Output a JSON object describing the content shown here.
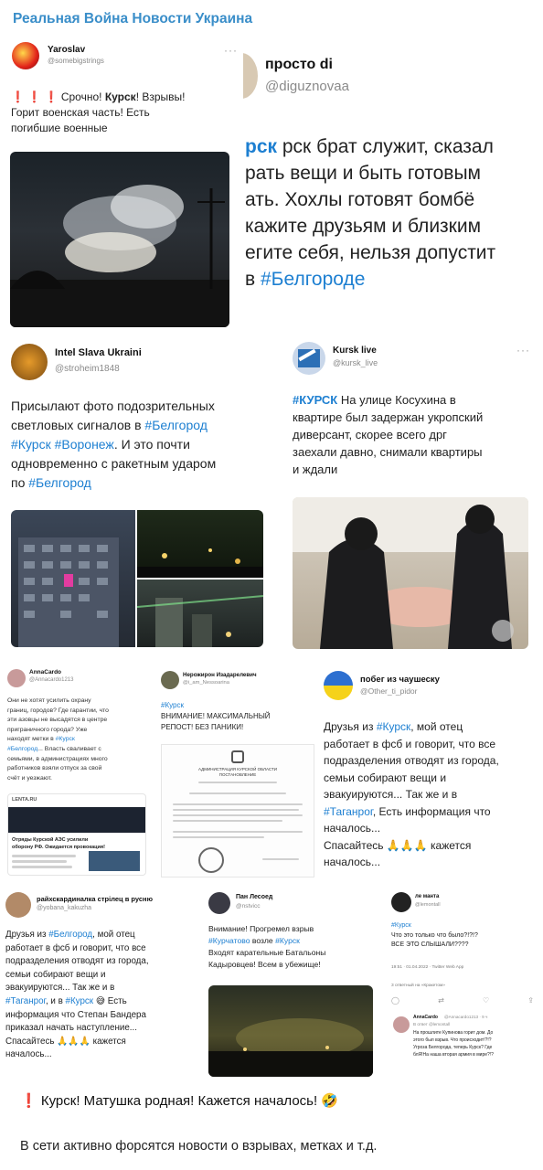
{
  "channel": {
    "title": "Реальная Война Новости Украина"
  },
  "t1": {
    "name": "Yaroslav",
    "handle": "@somebigstrings",
    "icon": "alert-icon",
    "line1_pre": "Срочно!",
    "line1_kw": "Курск",
    "line1_post": "! Взрывы!",
    "line2": "Горит военская часть! Есть",
    "line3": "погибшие военные"
  },
  "t2": {
    "name": "просто di",
    "handle": "@diguznovaa",
    "l1": "рск брат служит, сказал",
    "l2": "рать вещи и быть готовым",
    "l3": "ать. Хохлы готовят бомбё",
    "l4": "кажите друзьям и близким",
    "l5": "егите себя, нельзя допустит",
    "l6_pre": "в",
    "l6_tag": "#Белгороде"
  },
  "t3": {
    "name": "Intel Slava Ukraini",
    "handle": "@stroheim1848",
    "l1": "Присылают фото подозрительных",
    "l2_pre": "светловых сигналов в",
    "l2_tag": "#Белгород",
    "l3_tag1": "#Курск",
    "l3_tag2": "#Воронеж",
    "l3_post": ". И это почти",
    "l4": "одновременно с ракетным ударом",
    "l5_pre": "по",
    "l5_tag": "#Белгород"
  },
  "t4": {
    "name": "Kursk live",
    "handle": "@kursk_live",
    "l1_tag": "#КУРСК",
    "l1_post": "На улице Косухина в",
    "l2": "квартире был задержан укропский",
    "l3": "диверсант, скорее всего дрг",
    "l4": "заехали давно, снимали квартиры",
    "l5": "и ждали"
  },
  "t5": {
    "name": "AnnaCardo",
    "handle": "@Annacardo1213",
    "l1": "Они не хотят усилить охрану",
    "l2": "границ, городов? Где гарантии, что",
    "l3": "эти азовцы не высадятся в центре",
    "l4": "приграничного города? Уже",
    "l5_pre": "находят метки в",
    "l5_tag": "#Курск",
    "l6_tag": "#Белгород",
    "l6_post": "... Власть сваливает с",
    "l7": "семьями, в администрациях много",
    "l8": "работников взяли отпуск за свой",
    "l9": "счёт и уезжают.",
    "source": "LENTA.RU",
    "news1": "Отряды Курской АЭС усилили",
    "news2": "оборону РФ. Ожидается провокация!"
  },
  "t6": {
    "name": "Нерожирон Изадарелевич",
    "handle": "@i_am_Nessoarina",
    "tag": "#Курск",
    "l1": "ВНИМАНИЕ! МАКСИМАЛЬНЫЙ",
    "l2": "РЕПОСТ! БЕЗ ПАНИКИ!",
    "doc1": "АДМИНИСТРАЦИЯ КУРСКОЙ ОБЛАСТИ",
    "doc2": "ПОСТАНОВЛЕНИЕ"
  },
  "t7": {
    "name": "побег из чаушеску",
    "handle": "@Other_ti_pidor",
    "l1_pre": "Друзья из",
    "l1_tag": "#Курск",
    "l1_post": ", мой отец",
    "l2": "работает в фсб и говорит, что все",
    "l3": "подразделения отводят из города,",
    "l4": "семьи собирают вещи и",
    "l5": "эвакуируются... Так же и в",
    "l6_tag": "#Таганрог",
    "l6_post": ", Есть информация что",
    "l7": "началось...",
    "l8_pre": "Спасайтесь",
    "l8_post": "кажется",
    "l9": "началось..."
  },
  "t8": {
    "name": "райхскардиналка стрiлец в русню",
    "handle": "@yobana_kakuzha",
    "l1_pre": "Друзья из",
    "l1_tag": "#Белгород",
    "l1_post": ", мой отец",
    "l2": "работает в фсб и говорит, что все",
    "l3": "подразделения отводят из города,",
    "l4": "семьи собирают вещи и",
    "l5": "эвакуируются... Так же и в",
    "l6_tag1": "#Таганрог",
    "l6_mid": ", и в",
    "l6_tag2": "#Курск",
    "l6_post": "Есть",
    "l7": "информация что Степан Бандера",
    "l8": "приказал начать наступление...",
    "l9_pre": "Спасайтесь",
    "l9_post": "кажется",
    "l10": "началось..."
  },
  "t9": {
    "name": "Пан Лесоед",
    "handle": "@nstvicc",
    "l1": "Внимание! Прогремел взрыв",
    "l2_tag1": "#Курчатово",
    "l2_mid": "возле",
    "l2_tag2": "#Курск",
    "l3": "Входят карательные Батальоны",
    "l4": "Кадыровцев! Всем в убежище!"
  },
  "t10": {
    "name": "ле манта",
    "handle": "@lemontall",
    "tag": "#Курск",
    "l1": "Что это только что было?!?!?",
    "l2": "ВСЕ ЭТО СЛЫШАЛИ????",
    "meta": "19:51 · 01.04.2022 · Twitter Web App",
    "retweets": "3 ответный на «Кракетом»",
    "reply_name": "AnnaCardo",
    "reply_handle": "@Annacardo1213 · 9 ч",
    "reply_to": "В ответ @lemontall",
    "r1": "На прошлите Купинова горит дом. До",
    "r2": "этого был взрыв. Что происходит!?!?",
    "r3": "Угроза Белгорода, теперь Курск? Где",
    "r4": "блЯ!На наша вторая армия в мире?!?"
  },
  "footer": {
    "line1": "Курск! Матушка родная! Кажется началось!",
    "line2": "В сети активно форсятся новости о взрывах, метках и т.д."
  },
  "colors": {
    "accent": "#1d7fd1",
    "channel": "#3a8ec9"
  }
}
